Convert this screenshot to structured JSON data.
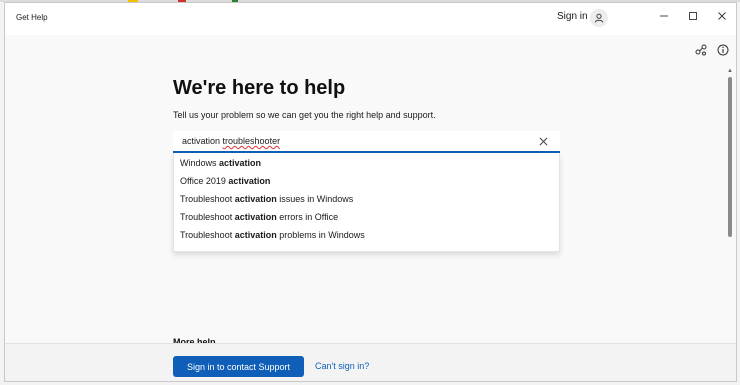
{
  "window": {
    "app_title": "Get Help",
    "sign_in_label": "Sign in",
    "controls": {
      "minimize_icon": "minimize-icon",
      "maximize_icon": "maximize-icon",
      "close_icon": "close-icon"
    }
  },
  "toolbar": {
    "icons": [
      "share-icon",
      "info-icon"
    ]
  },
  "main": {
    "heading": "We're here to help",
    "subtitle": "Tell us your problem so we can get you the right help and support.",
    "search": {
      "value_prefix": "activation ",
      "value_misspelled": "troubleshooter",
      "clear_icon": "close-icon"
    },
    "suggestions": [
      {
        "before": "Windows ",
        "bold": "activation",
        "after": ""
      },
      {
        "before": "Office 2019 ",
        "bold": "activation",
        "after": ""
      },
      {
        "before": "Troubleshoot ",
        "bold": "activation",
        "after": " issues in Windows"
      },
      {
        "before": "Troubleshoot ",
        "bold": "activation",
        "after": " errors in Office"
      },
      {
        "before": "Troubleshoot ",
        "bold": "activation",
        "after": " problems in Windows"
      }
    ],
    "more_help_label": "More help"
  },
  "footer": {
    "primary_button": "Sign in to contact Support",
    "link": "Can't sign in?"
  },
  "colors": {
    "accent": "#0f5fb8",
    "window_bg": "#f9f9f9",
    "titlebar_bg": "#ffffff"
  }
}
